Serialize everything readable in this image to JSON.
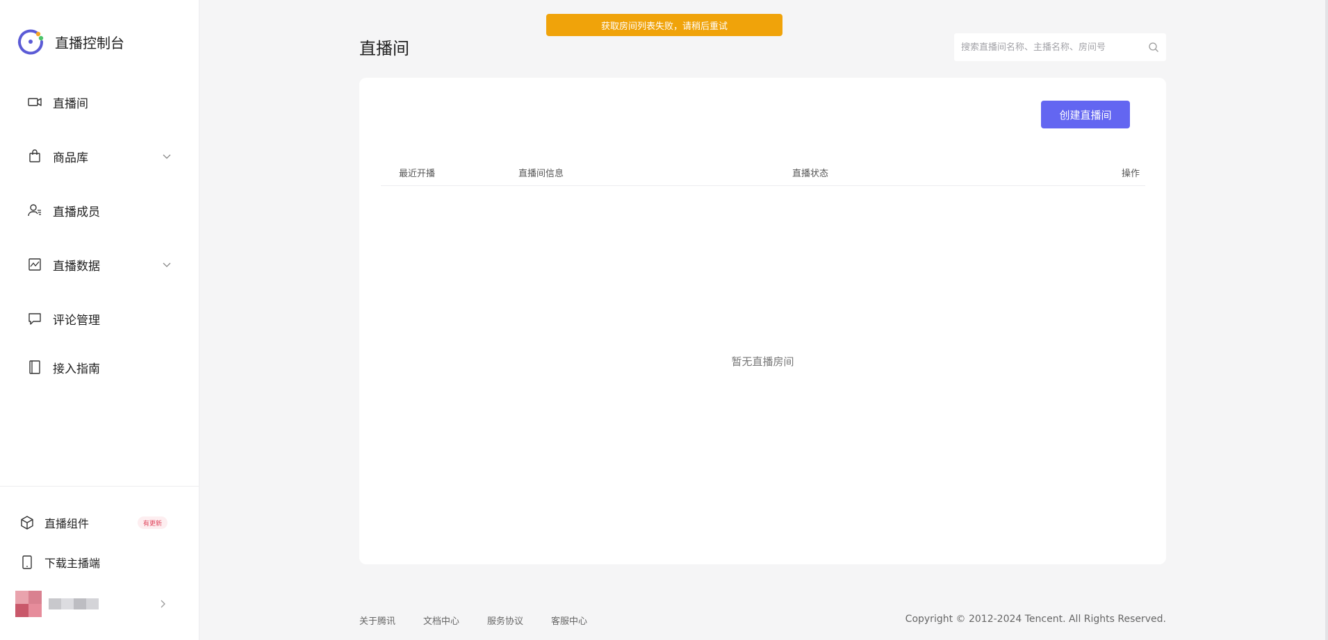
{
  "sidebar": {
    "brand_title": "直播控制台",
    "items": [
      {
        "label": "直播间",
        "icon": "video-camera-icon"
      },
      {
        "label": "商品库",
        "icon": "shopping-bag-icon",
        "expandable": true
      },
      {
        "label": "直播成员",
        "icon": "member-icon"
      },
      {
        "label": "直播数据",
        "icon": "data-chart-icon",
        "expandable": true
      },
      {
        "label": "评论管理",
        "icon": "comment-icon"
      },
      {
        "label": "接入指南",
        "icon": "book-icon"
      }
    ],
    "bottom": {
      "components_label": "直播组件",
      "components_badge": "有更新",
      "download_label": "下载主播端"
    }
  },
  "toast": {
    "message": "获取房间列表失败，请稍后重试"
  },
  "header": {
    "title": "直播间",
    "search_placeholder": "搜索直播间名称、主播名称、房间号"
  },
  "main": {
    "create_button": "创建直播间",
    "columns": [
      "最近开播",
      "直播间信息",
      "直播状态",
      "操作"
    ],
    "empty_text": "暂无直播房间"
  },
  "footer": {
    "links": [
      "关于腾讯",
      "文档中心",
      "服务协议",
      "客服中心"
    ],
    "copyright": "Copyright © 2012-2024 Tencent. All Rights Reserved."
  },
  "colors": {
    "accent": "#6366f1",
    "toast": "#f0a30a",
    "badge_text": "#e0455c"
  }
}
